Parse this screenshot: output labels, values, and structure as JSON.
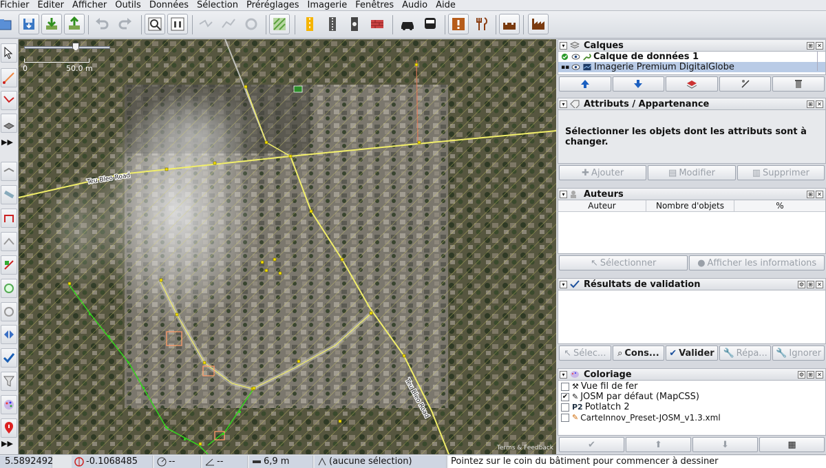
{
  "menu": [
    "Fichier",
    "Éditer",
    "Afficher",
    "Outils",
    "Données",
    "Sélection",
    "Préréglages",
    "Imagerie",
    "Fenêtres",
    "Audio",
    "Aide"
  ],
  "toolbar": {
    "icons": [
      "open-file-icon",
      "save-icon",
      "download-icon",
      "upload-icon",
      "undo-icon",
      "redo-icon",
      "zoom-to-data-icon",
      "preferences-icon",
      "split-way-icon",
      "combine-way-icon",
      "refresh-icon",
      "map-paint-icon",
      "road-pattern-icon",
      "railway-icon",
      "traffic-light-icon",
      "wall-icon",
      "car-icon",
      "bus-icon",
      "warning-icon",
      "restaurant-icon",
      "castle-icon",
      "factory-icon"
    ]
  },
  "map": {
    "scale_min": "0",
    "scale_max": "50.0 m",
    "road_name_1": "Teu Bleo Road",
    "road_name_2": "Teu Bleo Road",
    "attribution": "Terms & Feedback"
  },
  "panels": {
    "layers": {
      "title": "Calques",
      "items": [
        {
          "name": "Calque de données 1",
          "active": true,
          "selected": false
        },
        {
          "name": "Imagerie Premium DigitalGlobe",
          "active": false,
          "selected": true
        }
      ]
    },
    "attributes": {
      "title": "Attributs / Appartenance",
      "message": "Sélectionner les objets dont les attributs sont à changer.",
      "buttons": [
        "Ajouter",
        "Modifier",
        "Supprimer"
      ]
    },
    "authors": {
      "title": "Auteurs",
      "columns": [
        "Auteur",
        "Nombre d'objets",
        "%"
      ],
      "buttons": [
        "Sélectionner",
        "Afficher les informations"
      ]
    },
    "validation": {
      "title": "Résultats de validation",
      "buttons": [
        "Sélec...",
        "Cons...",
        "Valider",
        "Répa...",
        "Ignorer"
      ]
    },
    "styles": {
      "title": "Coloriage",
      "items": [
        {
          "label": "Vue fil de fer",
          "checked": false
        },
        {
          "label": "JOSM par défaut (MapCSS)",
          "checked": true
        },
        {
          "label": "Potlatch 2",
          "checked": false
        },
        {
          "label": "CarteInnov_Preset-JOSM_v1.3.xml",
          "checked": false
        }
      ]
    }
  },
  "status": {
    "lat": "5.5892492",
    "lon": "-0.1068485",
    "heading": "--",
    "angle": "--",
    "distance": "6,9 m",
    "selection": "(aucune sélection)",
    "message": "Pointez sur le coin du bâtiment pour commencer à dessiner"
  },
  "colors": {
    "road_yellow": "#f2ef6a",
    "way_green": "#35d11f",
    "node_yellow": "#ffe600",
    "selected_row": "#b9cbe6"
  }
}
